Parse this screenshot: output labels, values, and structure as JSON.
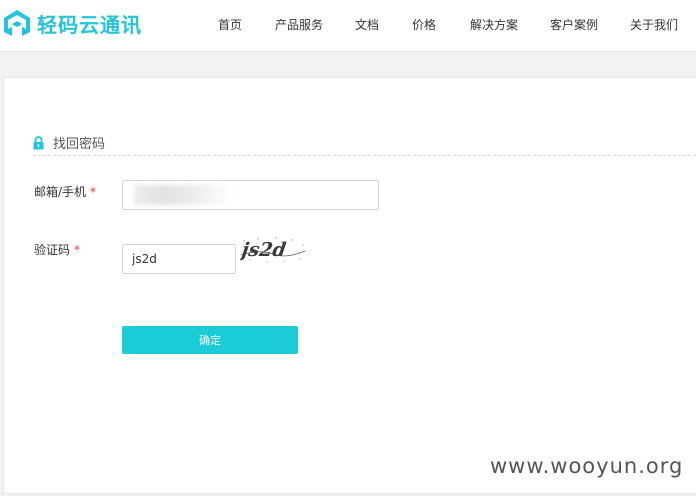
{
  "brand": {
    "name": "轻码云通讯",
    "color": "#21c4d8",
    "logo_icon": "house-logo-icon"
  },
  "nav": {
    "items": [
      {
        "label": "首页"
      },
      {
        "label": "产品服务"
      },
      {
        "label": "文档"
      },
      {
        "label": "价格"
      },
      {
        "label": "解决方案"
      },
      {
        "label": "客户案例"
      },
      {
        "label": "关于我们"
      }
    ]
  },
  "form": {
    "title": "找回密码",
    "title_icon": "lock-icon",
    "account_label": "邮箱/手机",
    "account_value": "",
    "code_label": "验证码",
    "code_value": "js2d",
    "required_mark": "*",
    "captcha_text": "js2d",
    "submit_label": "确定",
    "accent_color": "#1ccbd8",
    "required_color": "#e23b3b"
  },
  "watermark": "www.wooyun.org"
}
